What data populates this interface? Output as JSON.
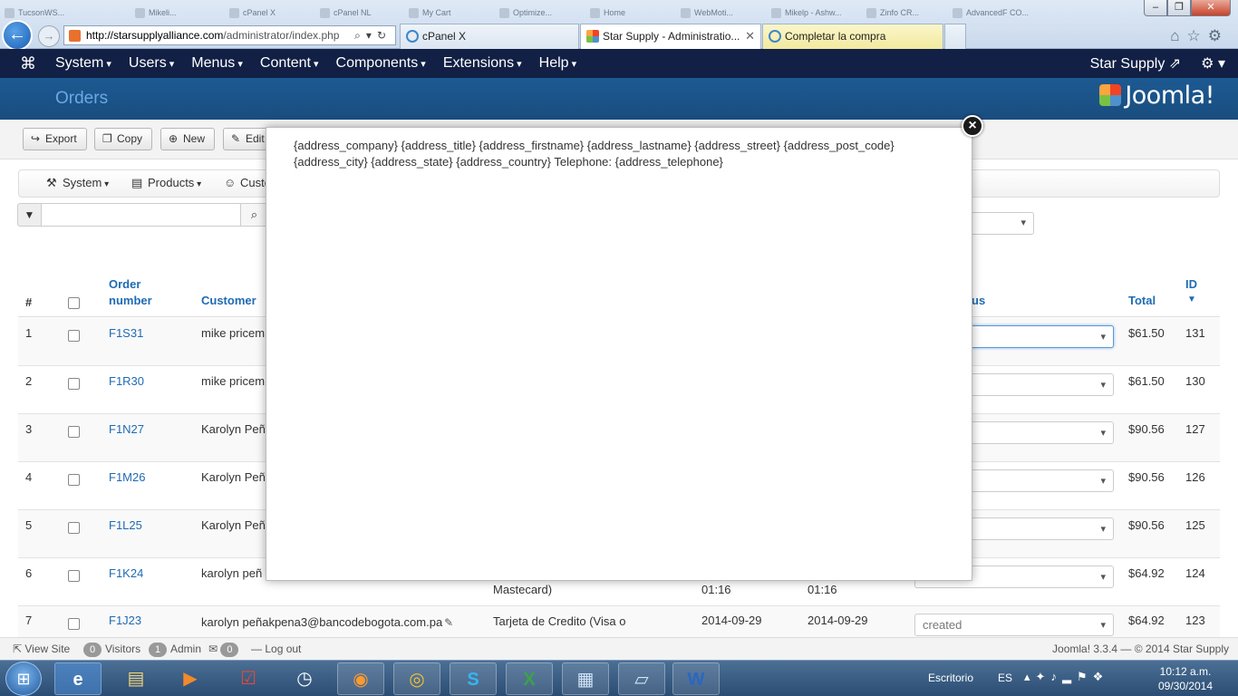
{
  "browser": {
    "top_tabs": [
      "TucsonWS...",
      "Mikeli...",
      "cPanel X",
      "cPanel NL",
      "My Cart",
      "Optimize...",
      "Home",
      "WebMoti...",
      "Mikelp - Ashw...",
      "Zinfo CR...",
      "AdvancedF CO..."
    ],
    "url_host": "http://starsupplyalliance.com",
    "url_path": "/administrator/index.php",
    "tabs": [
      {
        "label": "cPanel X"
      },
      {
        "label": "Star Supply - Administratio..."
      },
      {
        "label": "Completar la compra"
      }
    ],
    "window_controls": {
      "minimize": "–",
      "maximize": "❐",
      "close": "✕"
    }
  },
  "navbar": {
    "menu": [
      "System",
      "Users",
      "Menus",
      "Content",
      "Components",
      "Extensions",
      "Help"
    ],
    "site_link": "Star Supply ⇗",
    "gear": "⚙ ▾"
  },
  "subhead": {
    "title": "Orders",
    "brand": "Joomla!"
  },
  "toolbar": {
    "export": "Export",
    "copy": "Copy",
    "new": "New",
    "edit": "Edit"
  },
  "submenu": {
    "system": "System",
    "products": "Products",
    "customers": "Custo"
  },
  "table": {
    "headers": {
      "num": "#",
      "order_number": "Order number",
      "customer": "Customer",
      "status": "us",
      "total": "Total",
      "id": "ID"
    },
    "rows": [
      {
        "num": "1",
        "order": "F1S31",
        "customer": "mike pricem",
        "status": "",
        "total": "$61.50",
        "id": "131"
      },
      {
        "num": "2",
        "order": "F1R30",
        "customer": "mike pricem",
        "status": "",
        "total": "$61.50",
        "id": "130"
      },
      {
        "num": "3",
        "order": "F1N27",
        "customer": "Karolyn Peñ",
        "status": "",
        "total": "$90.56",
        "id": "127"
      },
      {
        "num": "4",
        "order": "F1M26",
        "customer": "Karolyn Peñ",
        "status": "",
        "total": "$90.56",
        "id": "126"
      },
      {
        "num": "5",
        "order": "F1L25",
        "customer": "Karolyn Peñ",
        "status": "",
        "total": "$90.56",
        "id": "125"
      },
      {
        "num": "6",
        "order": "F1K24",
        "customer": "karolyn peñ",
        "payment": "Mastecard)",
        "created": "01:16",
        "modified": "01:16",
        "status": "",
        "total": "$64.92",
        "id": "124"
      },
      {
        "num": "7",
        "order": "F1J23",
        "customer": "karolyn peñakpena3@bancodebogota.com.pa",
        "payment": "Tarjeta de Credito (Visa o",
        "created": "2014-09-29",
        "modified": "2014-09-29",
        "status": "created",
        "total": "$64.92",
        "id": "123"
      }
    ]
  },
  "modal": {
    "text": "{address_company} {address_title} {address_firstname} {address_lastname} {address_street} {address_post_code} {address_city} {address_state} {address_country} Telephone: {address_telephone}",
    "close": "×"
  },
  "statusbar": {
    "view_site": "View Site",
    "visitors_count": "0",
    "visitors": "Visitors",
    "admin_count": "1",
    "admin": "Admin",
    "messages_count": "0",
    "logout": "Log out",
    "version": "Joomla! 3.3.4 — © 2014 Star Supply"
  },
  "taskbar": {
    "desktop": "Escritorio",
    "lang": "ES",
    "time": "10:12 a.m.",
    "date": "09/30/2014"
  }
}
